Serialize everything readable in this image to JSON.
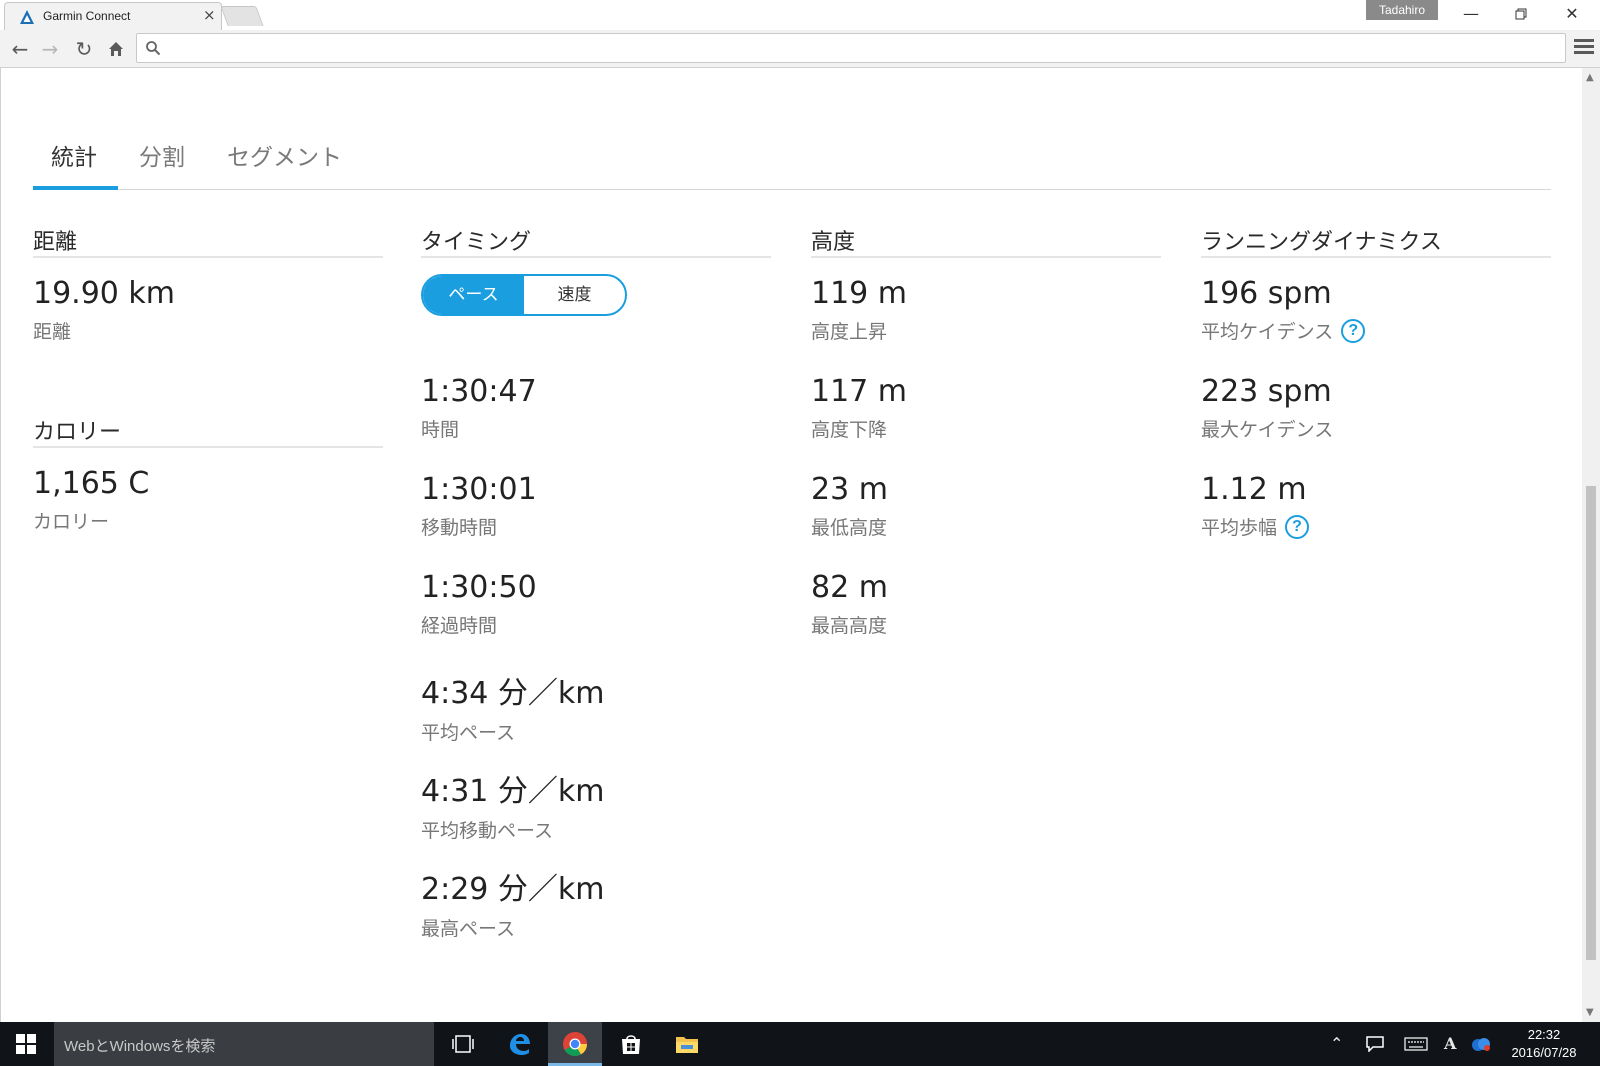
{
  "browser": {
    "tab_title": "Garmin Connect",
    "profile_name": "Tadahiro",
    "address_value": "",
    "address_placeholder": ""
  },
  "stats_tabs": [
    {
      "label": "統計",
      "active": true
    },
    {
      "label": "分割",
      "active": false
    },
    {
      "label": "セグメント",
      "active": false
    }
  ],
  "distance": {
    "heading": "距離",
    "items": [
      {
        "value": "19.90 km",
        "label": "距離"
      }
    ]
  },
  "calories": {
    "heading": "カロリー",
    "items": [
      {
        "value": "1,165 C",
        "label": "カロリー"
      }
    ]
  },
  "timing": {
    "heading": "タイミング",
    "toggle": {
      "pace": "ペース",
      "speed": "速度",
      "selected": "pace"
    },
    "items": [
      {
        "value": "1:30:47",
        "label": "時間"
      },
      {
        "value": "1:30:01",
        "label": "移動時間"
      },
      {
        "value": "1:30:50",
        "label": "経過時間"
      },
      {
        "value": "4:34 分／km",
        "label": "平均ペース"
      },
      {
        "value": "4:31 分／km",
        "label": "平均移動ペース"
      },
      {
        "value": "2:29 分／km",
        "label": "最高ペース"
      }
    ]
  },
  "elevation": {
    "heading": "高度",
    "items": [
      {
        "value": "119 m",
        "label": "高度上昇"
      },
      {
        "value": "117 m",
        "label": "高度下降"
      },
      {
        "value": "23 m",
        "label": "最低高度"
      },
      {
        "value": "82 m",
        "label": "最高高度"
      }
    ]
  },
  "running_dynamics": {
    "heading": "ランニングダイナミクス",
    "items": [
      {
        "value": "196 spm",
        "label": "平均ケイデンス",
        "help": true
      },
      {
        "value": "223 spm",
        "label": "最大ケイデンス",
        "help": false
      },
      {
        "value": "1.12 m",
        "label": "平均歩幅",
        "help": true
      }
    ]
  },
  "taskbar": {
    "search_placeholder": "WebとWindowsを検索",
    "time": "22:32",
    "date": "2016/07/28",
    "ime_indicator": "A"
  },
  "colors": {
    "accent": "#1a9ee0",
    "taskbar": "#101418"
  },
  "icons": [
    "back-icon",
    "forward-icon",
    "reload-icon",
    "home-icon",
    "search-icon",
    "menu-icon",
    "help-icon",
    "windows-start-icon",
    "task-view-icon",
    "edge-icon",
    "chrome-icon",
    "store-icon",
    "file-explorer-icon",
    "chevron-up-icon",
    "notification-icon",
    "keyboard-icon",
    "onedrive-icon"
  ]
}
